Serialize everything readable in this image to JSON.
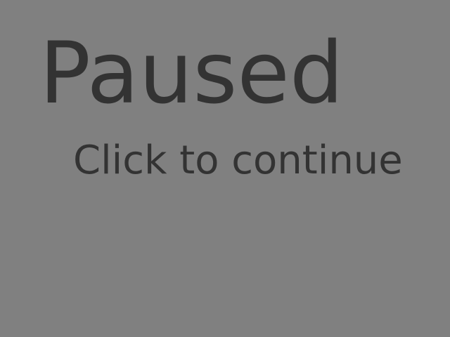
{
  "pause_screen": {
    "title": "Paused",
    "prompt": "Click to continue",
    "background_color": "#808080",
    "text_color": "#333333"
  }
}
